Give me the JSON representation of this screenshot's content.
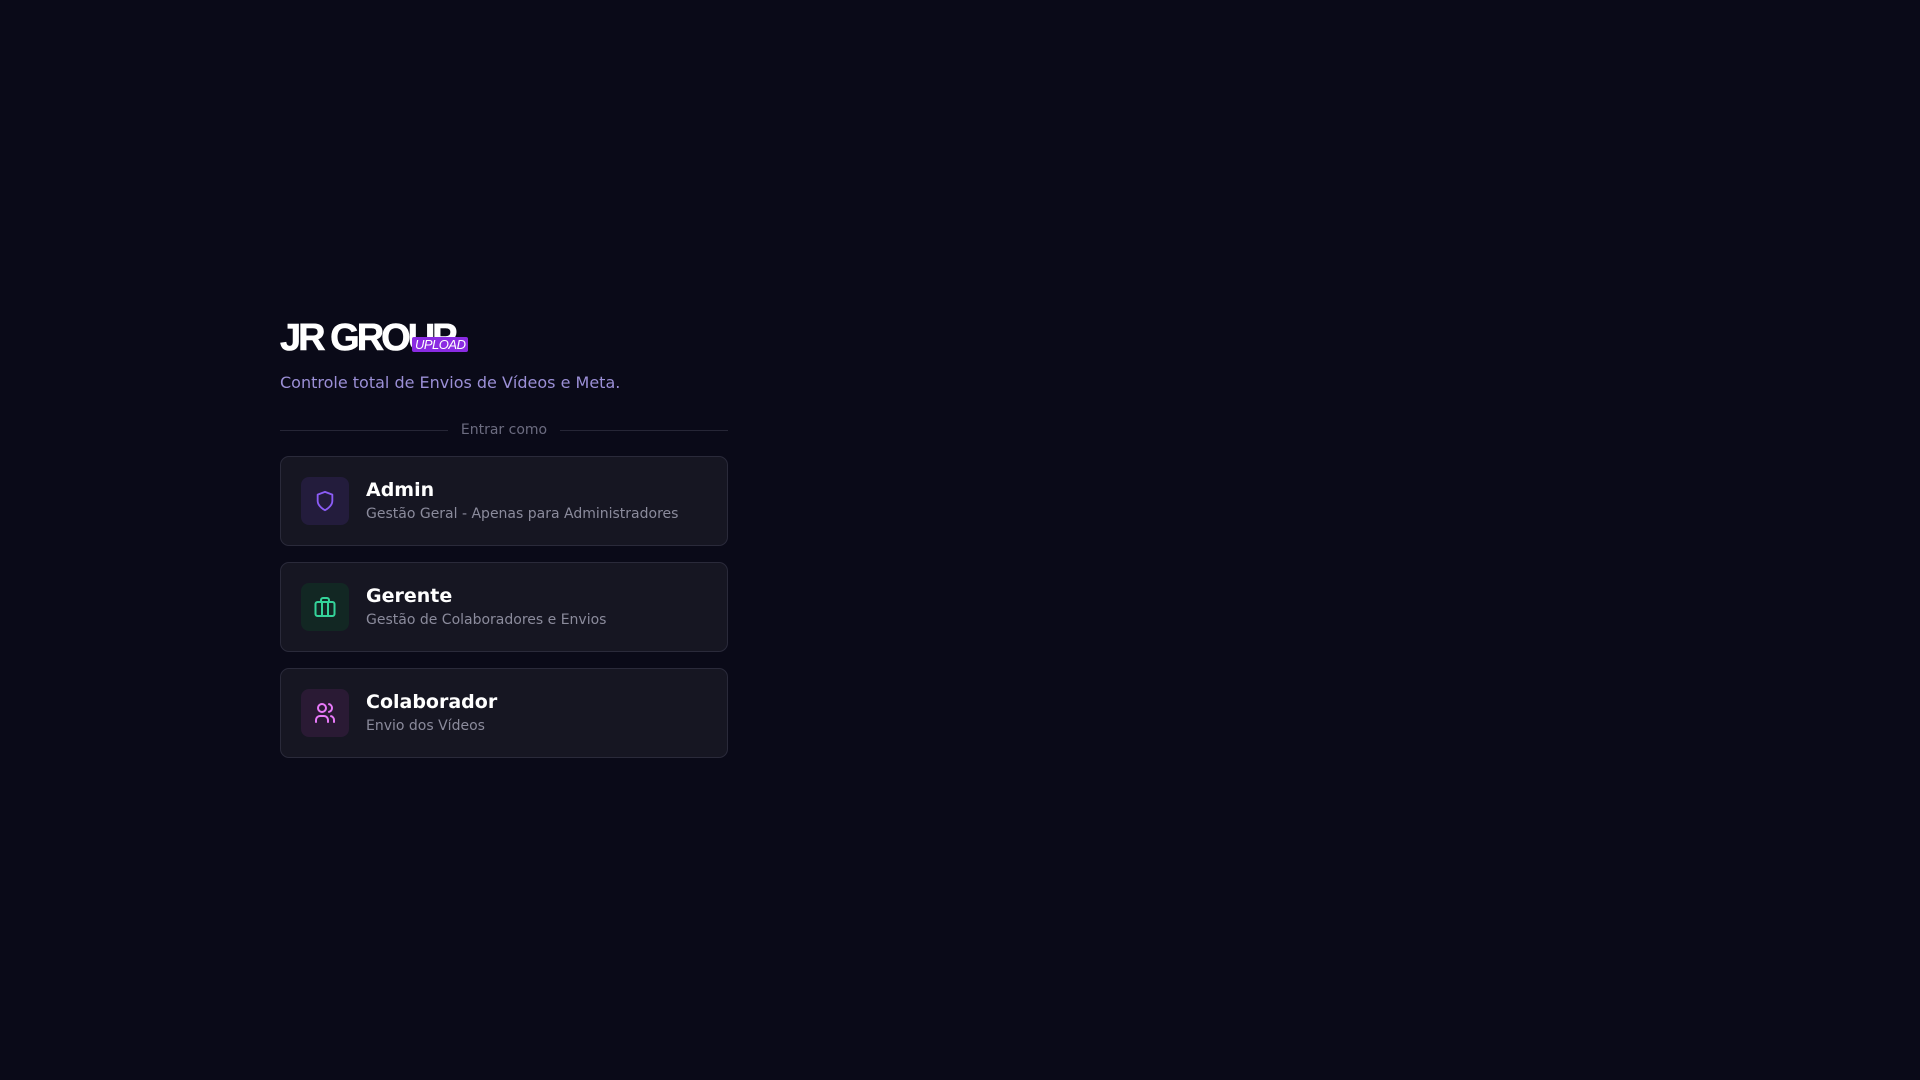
{
  "brand": {
    "logo_text": "JR GROUP",
    "logo_badge": "UPLOAD",
    "tagline": "Controle total de Envios de Vídeos e Meta."
  },
  "divider_label": "Entrar como",
  "roles": [
    {
      "title": "Admin",
      "description": "Gestão Geral - Apenas para Administradores",
      "icon": "shield-icon",
      "accent": "#8b5cf6"
    },
    {
      "title": "Gerente",
      "description": "Gestão de Colaboradores e Envios",
      "icon": "briefcase-icon",
      "accent": "#34d399"
    },
    {
      "title": "Colaborador",
      "description": "Envio dos Vídeos",
      "icon": "users-icon",
      "accent": "#e879f9"
    }
  ],
  "colors": {
    "background": "#0a0a18",
    "card": "#161622",
    "tagline": "#9b8fd6",
    "badge": "#8a2be2"
  }
}
